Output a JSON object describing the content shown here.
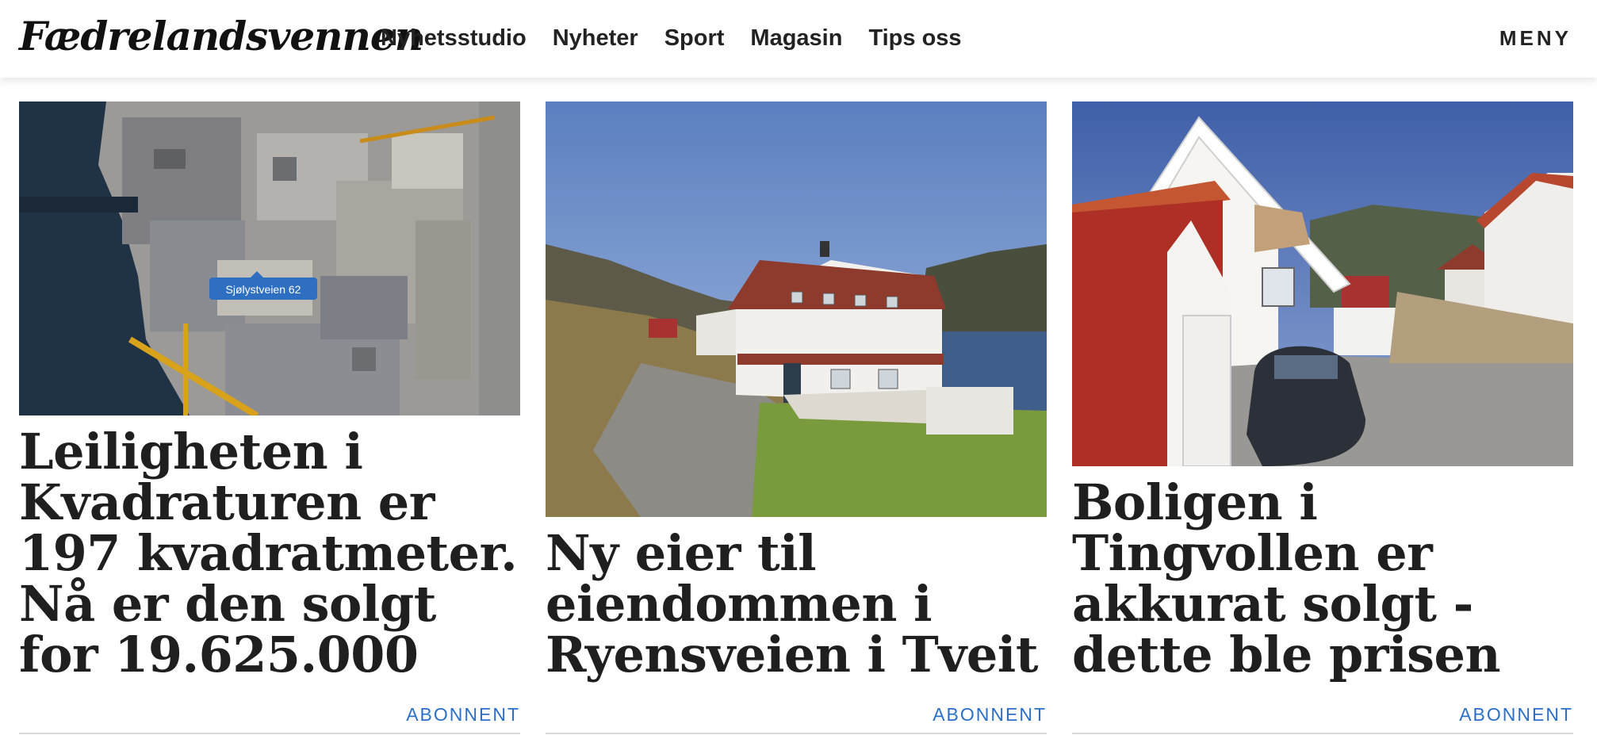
{
  "header": {
    "logo_text": "Fædrelandsvennen",
    "nav": [
      "Nyhetsstudio",
      "Nyheter",
      "Sport",
      "Magasin",
      "Tips oss"
    ],
    "menu_label": "MENY"
  },
  "articles": [
    {
      "title": "Leiligheten i Kvadraturen er 197 kvadratmeter. Nå er den solgt for 19.625.000",
      "image_type": "aerial-map",
      "map_label": "Sjølystveien 62",
      "badge": "ABONNENT"
    },
    {
      "title": "Ny eier til eiendommen i Ryensveien i Tveit",
      "image_type": "white-house-photo",
      "badge": "ABONNENT"
    },
    {
      "title": "Boligen i Tingvollen er akkurat solgt - dette ble prisen",
      "image_type": "white-house-street-photo",
      "badge": "ABONNENT"
    }
  ],
  "colors": {
    "badge": "#2a6fc9",
    "map_label_bg": "#2f6fc2"
  }
}
